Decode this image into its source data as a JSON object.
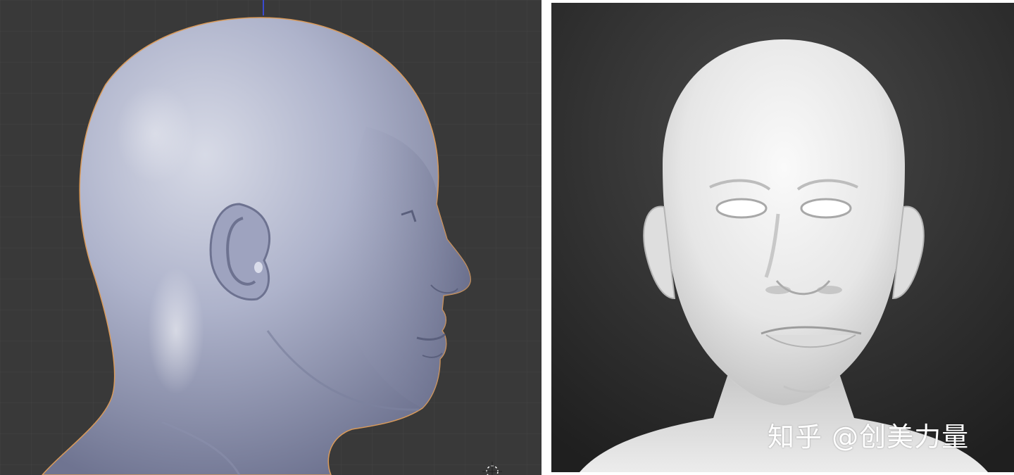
{
  "images": {
    "left": {
      "subject": "head-side-profile-3d-model",
      "background_color": "#393939",
      "outline_color": "#e0a060",
      "skin_color": "#a9aec6"
    },
    "right": {
      "subject": "head-front-3d-model",
      "background_color": "#2a2a2a",
      "skin_color": "#ececec"
    }
  },
  "watermark": {
    "text": "知乎 @创美力量"
  }
}
